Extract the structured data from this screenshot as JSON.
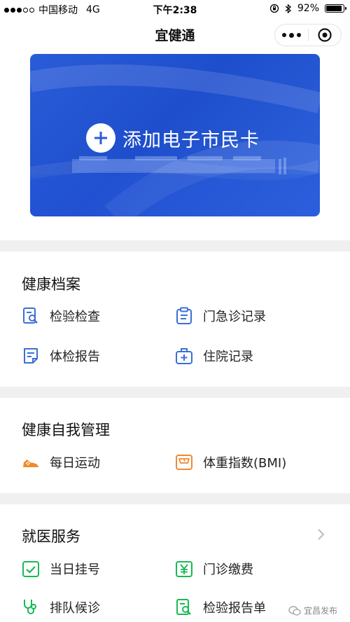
{
  "status_bar": {
    "carrier": "中国移动",
    "network": "4G",
    "time": "下午2:38",
    "battery": "92%",
    "battery_level": 0.92
  },
  "nav": {
    "title": "宜健通"
  },
  "banner": {
    "add_label": "添加电子市民卡"
  },
  "health_records": {
    "title": "健康档案",
    "items": [
      {
        "label": "检验检查",
        "icon": "lab-search-icon"
      },
      {
        "label": "门急诊记录",
        "icon": "clipboard-icon"
      },
      {
        "label": "体检报告",
        "icon": "document-icon"
      },
      {
        "label": "住院记录",
        "icon": "medical-kit-icon"
      }
    ]
  },
  "self_management": {
    "title": "健康自我管理",
    "items": [
      {
        "label": "每日运动",
        "icon": "sneaker-icon"
      },
      {
        "label": "体重指数(BMI)",
        "icon": "scale-icon"
      }
    ]
  },
  "medical_services": {
    "title": "就医服务",
    "items": [
      {
        "label": "当日挂号",
        "icon": "checkbox-icon"
      },
      {
        "label": "门诊缴费",
        "icon": "yuan-icon"
      },
      {
        "label": "排队候诊",
        "icon": "stethoscope-icon"
      },
      {
        "label": "检验报告单",
        "icon": "report-search-icon"
      }
    ]
  },
  "watermark": {
    "text": "宜昌发布"
  },
  "colors": {
    "blue": "#3b6fd6",
    "orange": "#f08a2c",
    "green": "#19b955",
    "banner": "#2a5cd8"
  }
}
